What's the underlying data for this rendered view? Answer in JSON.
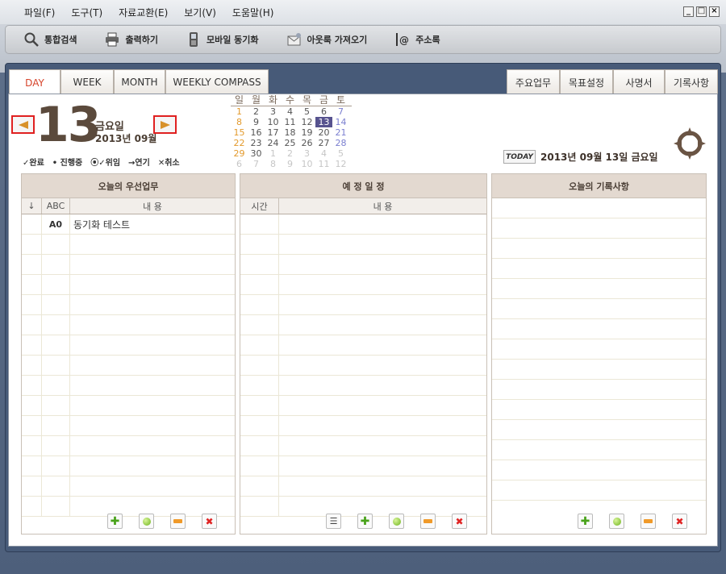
{
  "menu": [
    "파일(F)",
    "도구(T)",
    "자료교환(E)",
    "보기(V)",
    "도움말(H)"
  ],
  "toolbar": {
    "search": "통합검색",
    "print": "출력하기",
    "mobile_sync": "모바일 동기화",
    "outlook": "아웃룩 가져오기",
    "address": "주소록"
  },
  "tabs_left": [
    "DAY",
    "WEEK",
    "MONTH",
    "WEEKLY COMPASS"
  ],
  "tabs_right": [
    "주요업무",
    "목표설정",
    "사명서",
    "기록사항"
  ],
  "date": {
    "day": "13",
    "weekday": "금요일",
    "year_month": "2013년 09월"
  },
  "legend": [
    "✓완료",
    "• 진행중",
    "⦿✓위임",
    "→연기",
    "✕취소"
  ],
  "mini_calendar": {
    "headers": [
      "일",
      "월",
      "화",
      "수",
      "목",
      "금",
      "토"
    ],
    "weeks": [
      [
        "1",
        "2",
        "3",
        "4",
        "5",
        "6",
        "7"
      ],
      [
        "8",
        "9",
        "10",
        "11",
        "12",
        "13",
        "14"
      ],
      [
        "15",
        "16",
        "17",
        "18",
        "19",
        "20",
        "21"
      ],
      [
        "22",
        "23",
        "24",
        "25",
        "26",
        "27",
        "28"
      ],
      [
        "29",
        "30",
        "1",
        "2",
        "3",
        "4",
        "5"
      ],
      [
        "6",
        "7",
        "8",
        "9",
        "10",
        "11",
        "12"
      ]
    ]
  },
  "today": {
    "badge": "TODAY",
    "text": "2013년 09월 13일 금요일"
  },
  "priority": {
    "title": "오늘의 우선업무",
    "col_arrow": "↓",
    "col_abc": "ABC",
    "col_content": "내 용",
    "rows": [
      {
        "grade": "A0",
        "content": "동기화 테스트"
      }
    ]
  },
  "schedule": {
    "title": "예 정 일 정",
    "col_time": "시간",
    "col_content": "내 용"
  },
  "notes": {
    "title": "오늘의 기록사항"
  }
}
